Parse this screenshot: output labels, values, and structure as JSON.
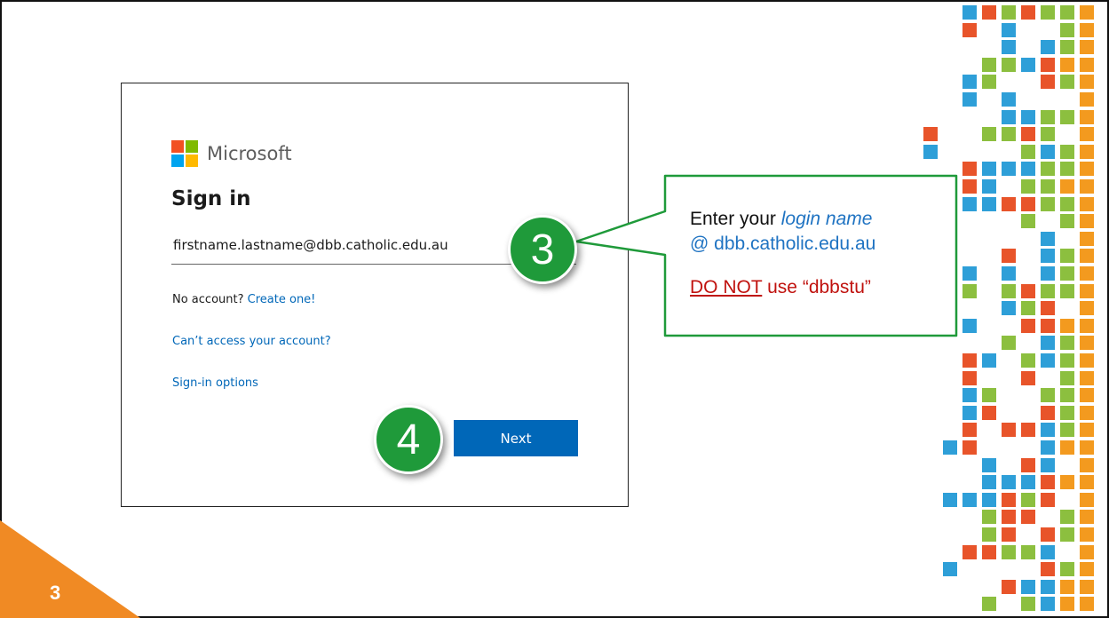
{
  "brand": {
    "name": "Microsoft",
    "logo_colors": [
      "#f25022",
      "#7fba00",
      "#00a4ef",
      "#ffb900"
    ]
  },
  "signin": {
    "title": "Sign in",
    "email_value": "firstname.lastname@dbb.catholic.edu.au",
    "no_account_text": "No account?",
    "create_link": "Create one!",
    "cant_access_link": "Can’t access your account?",
    "options_link": "Sign-in options",
    "next_label": "Next"
  },
  "steps": {
    "step_email": "3",
    "step_next": "4"
  },
  "callout": {
    "line1_prefix": "Enter your ",
    "line1_emphasis": "login name",
    "line2_at": "@ ",
    "line2_domain": "dbb.catholic.edu.au",
    "warning_underlined": "DO NOT",
    "warning_rest": " use “dbbstu”"
  },
  "slide": {
    "page_number": "3"
  },
  "colors": {
    "accent_green": "#1f9a3a",
    "link_blue": "#0067b8",
    "corner_orange": "#f08a24",
    "mosaic": [
      "#2e9fd8",
      "#e8542a",
      "#8cbf3f",
      "#f39a1f"
    ]
  }
}
